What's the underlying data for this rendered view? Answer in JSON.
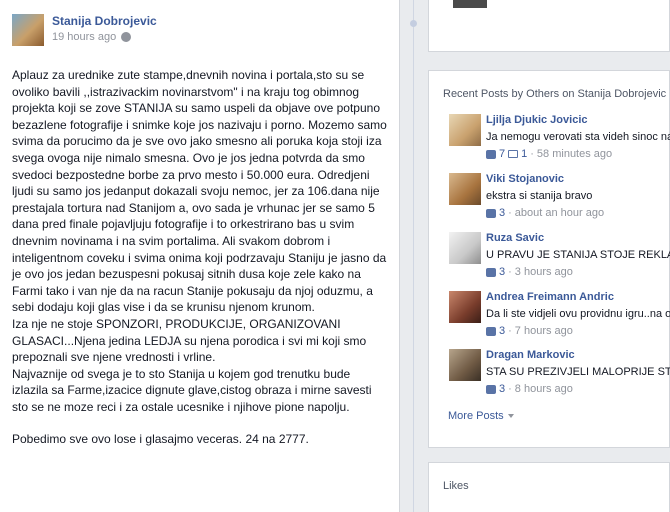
{
  "post": {
    "author": "Stanija Dobrojevic",
    "time": "19 hours ago",
    "paragraphs": [
      "Aplauz za urednike zute stampe,dnevnih novina i portala,sto su se ovoliko bavili ,,istrazivackim novinarstvom\" i na kraju tog obimnog projekta koji se zove STANIJA su samo uspeli da objave ove potpuno bezazlene fotografije i snimke koje jos nazivaju i porno. Mozemo samo svima da porucimo da je sve ovo jako smesno ali poruka koja stoji iza svega ovoga nije nimalo smesna. Ovo je jos jedna potvrda da smo svedoci bezpostedne borbe za prvo mesto i 50.000 eura. Odredjeni ljudi su samo jos jedanput dokazali svoju nemoc, jer za 106.dana nije prestajala tortura nad Stanijom a, ovo sada je vrhunac jer se samo 5 dana pred finale pojavljuju fotografije i to orkestrirano bas u svim dnevnim novinama i na svim portalima. Ali svakom dobrom i inteligentnom coveku i svima onima koji podrzavaju Staniju je jasno da je ovo jos jedan bezuspesni pokusaj sitnih dusa koje zele kako na Farmi tako i van nje da na racun Stanije pokusaju da njoj oduzmu, a sebi dodaju koji glas vise i da se krunisu njenom krunom.",
      "Iza nje ne stoje SPONZORI, PRODUKCIJE, ORGANIZOVANI GLASACI...Njena jedina LEDJA su njena porodica i svi mi koji smo prepoznali sve njene vrednosti i vrline.",
      "Najvaznije od svega je to sto Stanija u kojem god trenutku bude izlazila sa Farme,izacice dignute glave,cistog obraza i mirne savesti sto se ne moze reci i za ostale ucesnike i njihove pione napolju.",
      "Pobedimo sve ovo lose i glasajmo veceras. 24 na 2777."
    ]
  },
  "recent": {
    "title": "Recent Posts by Others on Stanija Dobrojevic",
    "posts": [
      {
        "name": "Ljilja Djukic Jovicic",
        "message": "Ja nemogu verovati sta videh sinoc na",
        "likes": "7",
        "comments": "1",
        "time": "58 minutes ago"
      },
      {
        "name": "Viki Stojanovic",
        "message": "ekstra si stanija bravo",
        "likes": "3",
        "time": "about an hour ago"
      },
      {
        "name": "Ruza Savic",
        "message": "U PRAVU JE STANIJA STOJE REKLA JOV",
        "likes": "3",
        "time": "3 hours ago"
      },
      {
        "name": "Andrea Freimann Andric",
        "message": "Da li ste vidjeli ovu providnu igru..na ov",
        "likes": "3",
        "time": "7 hours ago"
      },
      {
        "name": "Dragan Markovic",
        "message": "STA SU PREZIVJELI MALOPRIJE STANI",
        "likes": "3",
        "time": "8 hours ago"
      }
    ],
    "more": "More Posts"
  },
  "likes": {
    "title": "Likes"
  },
  "colors": {
    "link": "#3b5998",
    "muted": "#90949c",
    "background": "#e9ebee"
  }
}
